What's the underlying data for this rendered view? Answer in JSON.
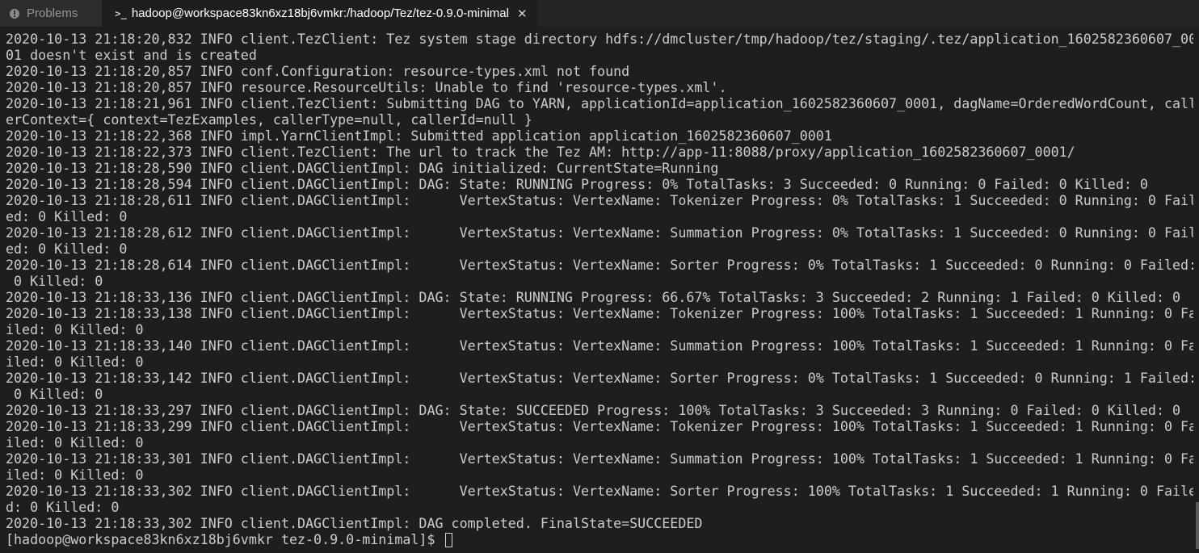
{
  "tabs": {
    "problems_label": "Problems",
    "terminal_title": "hadoop@workspace83kn6xz18bj6vmkr:/hadoop/Tez/tez-0.9.0-minimal"
  },
  "icons": {
    "problems": "problems-icon",
    "terminal": "terminal-icon",
    "close": "close-icon"
  },
  "terminal": {
    "lines": [
      "2020-10-13 21:18:20,832 INFO client.TezClient: Tez system stage directory hdfs://dmcluster/tmp/hadoop/tez/staging/.tez/application_1602582360607_00",
      "01 doesn't exist and is created",
      "2020-10-13 21:18:20,857 INFO conf.Configuration: resource-types.xml not found",
      "2020-10-13 21:18:20,857 INFO resource.ResourceUtils: Unable to find 'resource-types.xml'.",
      "2020-10-13 21:18:21,961 INFO client.TezClient: Submitting DAG to YARN, applicationId=application_1602582360607_0001, dagName=OrderedWordCount, call",
      "erContext={ context=TezExamples, callerType=null, callerId=null }",
      "2020-10-13 21:18:22,368 INFO impl.YarnClientImpl: Submitted application application_1602582360607_0001",
      "2020-10-13 21:18:22,373 INFO client.TezClient: The url to track the Tez AM: http://app-11:8088/proxy/application_1602582360607_0001/",
      "2020-10-13 21:18:28,590 INFO client.DAGClientImpl: DAG initialized: CurrentState=Running",
      "2020-10-13 21:18:28,594 INFO client.DAGClientImpl: DAG: State: RUNNING Progress: 0% TotalTasks: 3 Succeeded: 0 Running: 0 Failed: 0 Killed: 0",
      "2020-10-13 21:18:28,611 INFO client.DAGClientImpl:      VertexStatus: VertexName: Tokenizer Progress: 0% TotalTasks: 1 Succeeded: 0 Running: 0 Fail",
      "ed: 0 Killed: 0",
      "2020-10-13 21:18:28,612 INFO client.DAGClientImpl:      VertexStatus: VertexName: Summation Progress: 0% TotalTasks: 1 Succeeded: 0 Running: 0 Fail",
      "ed: 0 Killed: 0",
      "2020-10-13 21:18:28,614 INFO client.DAGClientImpl:      VertexStatus: VertexName: Sorter Progress: 0% TotalTasks: 1 Succeeded: 0 Running: 0 Failed:",
      " 0 Killed: 0",
      "2020-10-13 21:18:33,136 INFO client.DAGClientImpl: DAG: State: RUNNING Progress: 66.67% TotalTasks: 3 Succeeded: 2 Running: 1 Failed: 0 Killed: 0",
      "2020-10-13 21:18:33,138 INFO client.DAGClientImpl:      VertexStatus: VertexName: Tokenizer Progress: 100% TotalTasks: 1 Succeeded: 1 Running: 0 Fa",
      "iled: 0 Killed: 0",
      "2020-10-13 21:18:33,140 INFO client.DAGClientImpl:      VertexStatus: VertexName: Summation Progress: 100% TotalTasks: 1 Succeeded: 1 Running: 0 Fa",
      "iled: 0 Killed: 0",
      "2020-10-13 21:18:33,142 INFO client.DAGClientImpl:      VertexStatus: VertexName: Sorter Progress: 0% TotalTasks: 1 Succeeded: 0 Running: 1 Failed:",
      " 0 Killed: 0",
      "2020-10-13 21:18:33,297 INFO client.DAGClientImpl: DAG: State: SUCCEEDED Progress: 100% TotalTasks: 3 Succeeded: 3 Running: 0 Failed: 0 Killed: 0",
      "2020-10-13 21:18:33,299 INFO client.DAGClientImpl:      VertexStatus: VertexName: Tokenizer Progress: 100% TotalTasks: 1 Succeeded: 1 Running: 0 Fa",
      "iled: 0 Killed: 0",
      "2020-10-13 21:18:33,301 INFO client.DAGClientImpl:      VertexStatus: VertexName: Summation Progress: 100% TotalTasks: 1 Succeeded: 1 Running: 0 Fa",
      "iled: 0 Killed: 0",
      "2020-10-13 21:18:33,302 INFO client.DAGClientImpl:      VertexStatus: VertexName: Sorter Progress: 100% TotalTasks: 1 Succeeded: 1 Running: 0 Faile",
      "d: 0 Killed: 0",
      "2020-10-13 21:18:33,302 INFO client.DAGClientImpl: DAG completed. FinalState=SUCCEEDED"
    ],
    "prompt": "[hadoop@workspace83kn6xz18bj6vmkr tez-0.9.0-minimal]$ "
  },
  "colors": {
    "background": "#1e1e1e",
    "tabbar": "#252526",
    "text": "#cccccc"
  }
}
